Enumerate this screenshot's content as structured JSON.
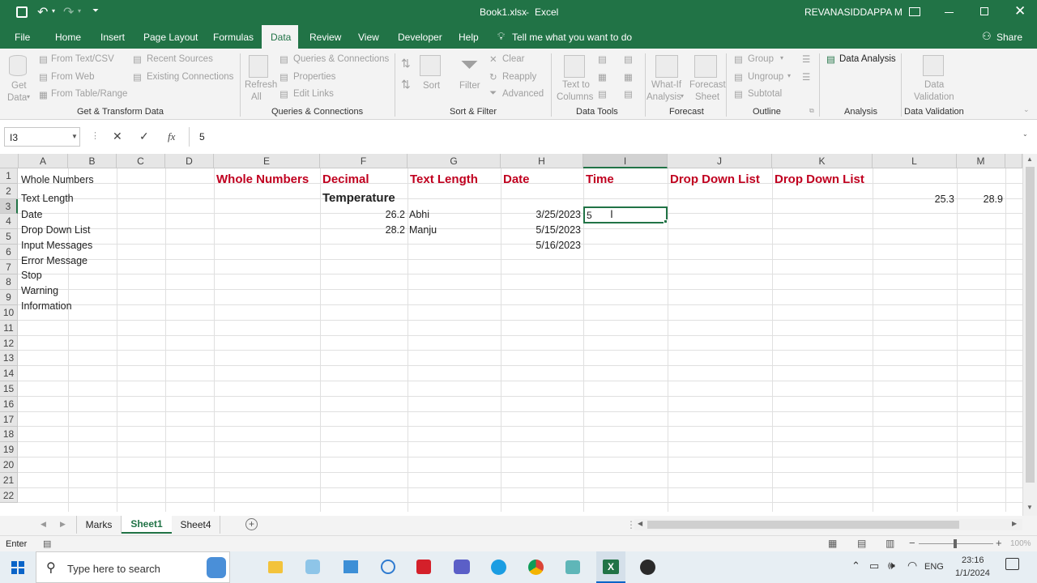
{
  "titlebar": {
    "filename": "Book1.xlsx",
    "app": "Excel",
    "separator": "-",
    "user": "REVANASIDDAPPA M"
  },
  "menu": [
    "File",
    "Home",
    "Insert",
    "Page Layout",
    "Formulas",
    "Data",
    "Review",
    "View",
    "Developer",
    "Help"
  ],
  "menu_active": "Data",
  "tellme": "Tell me what you want to do",
  "share": "Share",
  "ribbon": {
    "get_data": [
      "Get",
      "Data"
    ],
    "from_text": "From Text/CSV",
    "from_web": "From Web",
    "from_table": "From Table/Range",
    "recent_sources": "Recent Sources",
    "existing_connections": "Existing Connections",
    "group_get_transform": "Get & Transform Data",
    "refresh": [
      "Refresh",
      "All"
    ],
    "queries_connections": "Queries & Connections",
    "properties": "Properties",
    "edit_links": "Edit Links",
    "group_queries": "Queries & Connections",
    "sort": "Sort",
    "filter": "Filter",
    "clear": "Clear",
    "reapply": "Reapply",
    "advanced": "Advanced",
    "group_sort": "Sort & Filter",
    "text_to_columns": [
      "Text to",
      "Columns"
    ],
    "group_datatools": "Data Tools",
    "whatif": [
      "What-If",
      "Analysis"
    ],
    "forecast_sheet": [
      "Forecast",
      "Sheet"
    ],
    "group_forecast": "Forecast",
    "group_btn": "Group",
    "ungroup": "Ungroup",
    "subtotal": "Subtotal",
    "group_outline": "Outline",
    "data_analysis": "Data Analysis",
    "group_analysis": "Analysis",
    "data_validation": [
      "Data",
      "Validation"
    ],
    "group_validation": "Data Validation"
  },
  "formula_bar": {
    "name_box": "I3",
    "fx": "fx",
    "value": "5"
  },
  "columns": [
    "A",
    "B",
    "C",
    "D",
    "E",
    "F",
    "G",
    "H",
    "I",
    "J",
    "K",
    "L",
    "M"
  ],
  "rows": [
    "1",
    "2",
    "3",
    "4",
    "5",
    "6",
    "7",
    "8",
    "9",
    "10",
    "11",
    "12",
    "13",
    "14",
    "15",
    "16",
    "17",
    "18",
    "19",
    "20",
    "21",
    "22"
  ],
  "cells": {
    "A1": "Whole Numbers",
    "A2": "Text Length",
    "A3": "Date",
    "A4": "Drop Down List",
    "A5": "Input Messages",
    "A6": "Error Message",
    "A7": "Stop",
    "A8": "Warning",
    "A9": "Information",
    "E1": "Whole Numbers",
    "F1": "Decimal",
    "G1": "Text Length",
    "H1": "Date",
    "I1": "Time",
    "J1": "Drop Down List",
    "K1": "Drop Down List",
    "F2": "Temperature",
    "L2": "25.3",
    "M2": "28.9",
    "F3": "26.2",
    "G3": "Abhi",
    "H3": "3/25/2023",
    "I3": "5",
    "F4": "28.2",
    "G4": "Manju",
    "H4": "5/15/2023",
    "H5": "5/16/2023"
  },
  "sheets": [
    "Marks",
    "Sheet1",
    "Sheet4"
  ],
  "active_sheet": "Sheet1",
  "status": {
    "mode": "Enter",
    "zoom": "100%"
  },
  "taskbar": {
    "search_placeholder": "Type here to search",
    "lang": "ENG",
    "time": "23:16",
    "date": "1/1/2024"
  },
  "colors": {
    "excel_green": "#217346",
    "header_red": "#c0001f"
  }
}
